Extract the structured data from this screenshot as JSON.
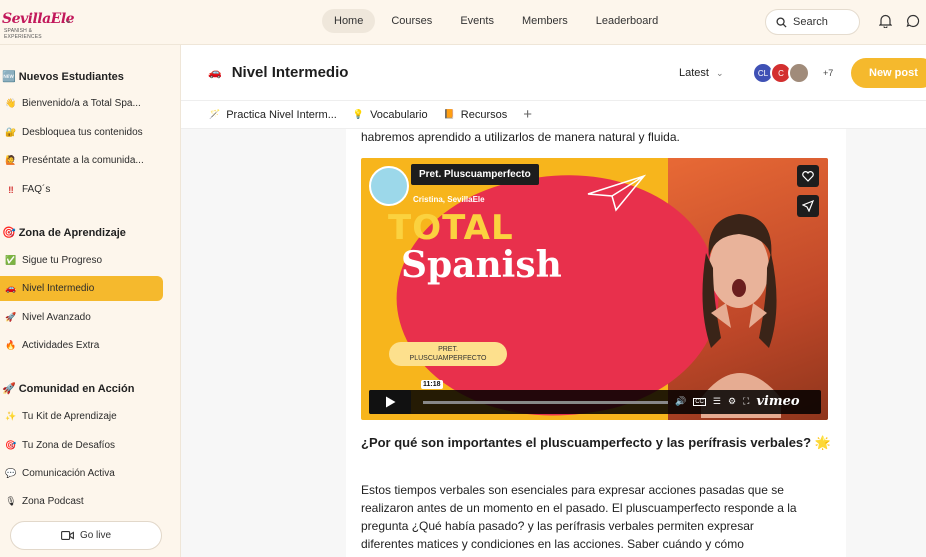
{
  "topbar": {
    "logo_text": "SevillaEle",
    "logo_sub": "SPANISH & EXPERIENCES",
    "nav": [
      "Home",
      "Courses",
      "Events",
      "Members",
      "Leaderboard"
    ],
    "search_label": "Search"
  },
  "sidebar": {
    "sections": [
      {
        "title": "Nuevos Estudiantes",
        "icon": "🆕",
        "items": [
          {
            "icon": "👋",
            "label": "Bienvenido/a a Total Spa..."
          },
          {
            "icon": "🔐",
            "label": "Desbloquea tus contenidos"
          },
          {
            "icon": "🙋",
            "label": "Preséntate a la comunida..."
          },
          {
            "icon": "‼",
            "label": "FAQ´s"
          }
        ]
      },
      {
        "title": "Zona de Aprendizaje",
        "icon": "🎯",
        "items": [
          {
            "icon": "✅",
            "label": "Sigue tu Progreso"
          },
          {
            "icon": "🚗",
            "label": "Nivel Intermedio"
          },
          {
            "icon": "🚀",
            "label": "Nivel Avanzado"
          },
          {
            "icon": "🔥",
            "label": "Actividades Extra"
          }
        ]
      },
      {
        "title": "Comunidad en Acción",
        "icon": "🚀",
        "items": [
          {
            "icon": "✨",
            "label": "Tu Kit de Aprendizaje"
          },
          {
            "icon": "🎯",
            "label": "Tu Zona de Desafíos"
          },
          {
            "icon": "💬",
            "label": "Comunicación Activa"
          },
          {
            "icon": "🎙",
            "label": "Zona Podcast"
          }
        ]
      }
    ],
    "go_live": "Go live"
  },
  "header": {
    "title": "Nivel Intermedio",
    "sort": "Latest",
    "avatars": [
      {
        "initials": "CL",
        "color": "#3f51b5"
      },
      {
        "initials": "C",
        "color": "#d32f2f"
      },
      {
        "initials": "",
        "color": "#9e8a7a"
      }
    ],
    "more_count": "+7",
    "new_post": "New post"
  },
  "tabs": [
    {
      "icon": "🪄",
      "label": "Practica Nivel Interm..."
    },
    {
      "icon": "💡",
      "label": "Vocabulario"
    },
    {
      "icon": "📙",
      "label": "Recursos"
    }
  ],
  "post": {
    "lead_line": "habremos aprendido a utilizarlos de manera natural y fluida.",
    "video": {
      "channel_title": "Pret. Pluscuamperfecto",
      "channel_sub": "Cristina, SevillaEle",
      "big_title_1": "TOTAL",
      "big_title_2": "Spanish",
      "pill_text_1": "PRET.",
      "pill_text_2": "PLUSCUAMPERFECTO",
      "time": "11:18",
      "vimeo": "vimeo"
    },
    "heading": "¿Por qué son importantes el pluscuamperfecto y las perífrasis verbales? 🌟",
    "body": [
      "Estos tiempos verbales son esenciales para expresar acciones pasadas que se",
      "realizaron antes de un momento en el pasado. El pluscuamperfecto responde a la",
      "pregunta ¿Qué había pasado? y las perífrasis verbales permiten expresar",
      "diferentes matices y condiciones en las acciones. Saber cuándo y cómo"
    ]
  }
}
